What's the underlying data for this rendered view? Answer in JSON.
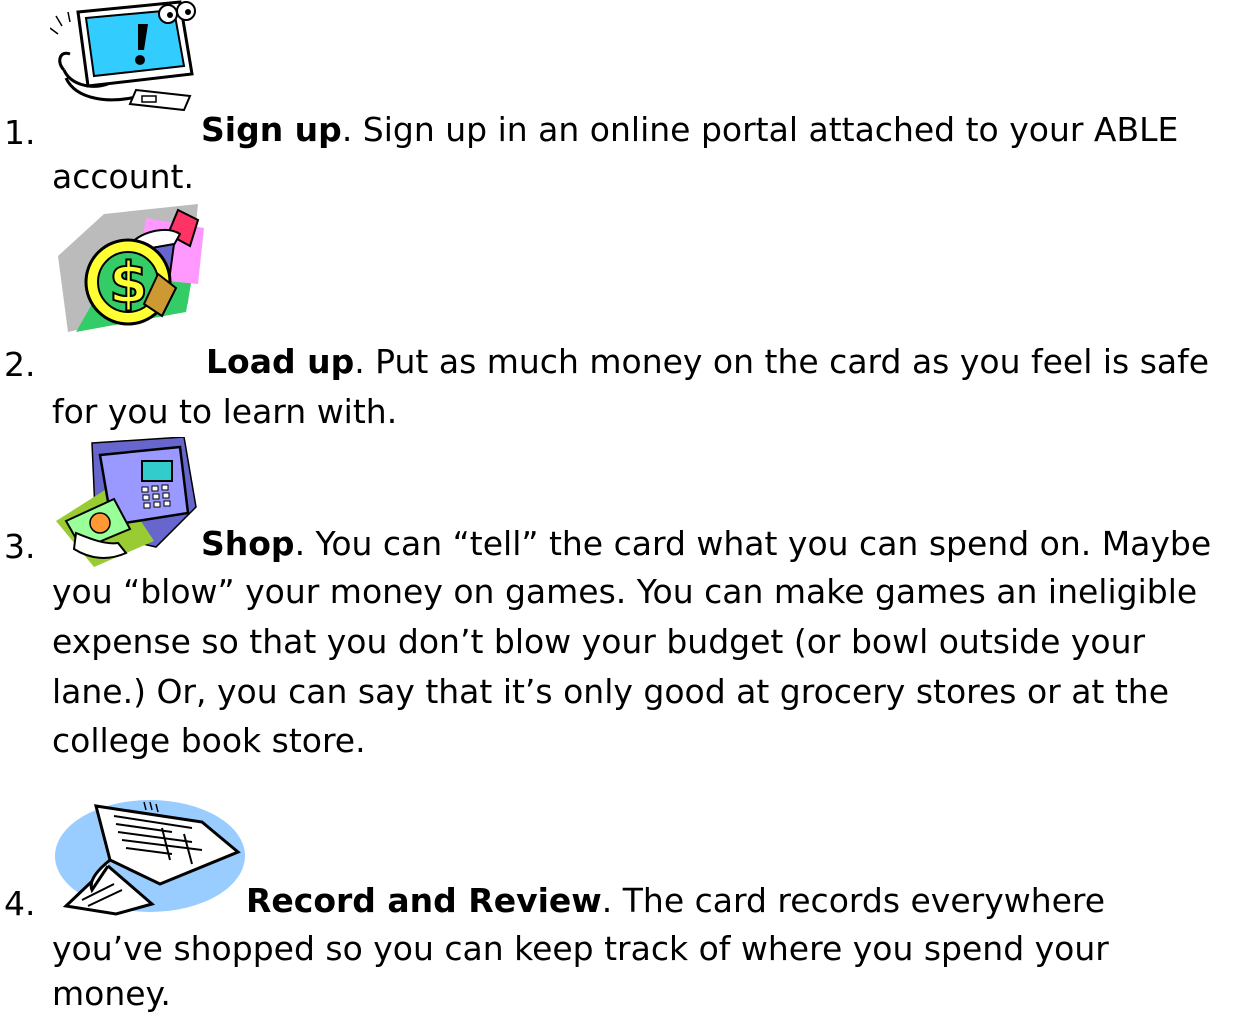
{
  "steps": [
    {
      "number": "1.",
      "title": "Sign up",
      "first_line": ". Sign up in an online portal attached to your ABLE",
      "lines": [
        "account."
      ],
      "icon": "computer-monitor-clipart-icon"
    },
    {
      "number": "2.",
      "title": "Load up",
      "first_line": ". Put as much money on the card as you feel is safe",
      "lines": [
        "for you to learn with."
      ],
      "icon": "money-dollar-clipart-icon"
    },
    {
      "number": "3.",
      "title": "Shop",
      "first_line": ". You can “tell” the card what you can spend on. Maybe",
      "lines": [
        "you “blow” your money on games. You can make games an ineligible",
        "expense so that you don’t blow your budget (or bowl outside your",
        "lane.) Or, you can say that it’s only good at grocery stores or at the",
        "college book store."
      ],
      "icon": "card-payment-terminal-clipart-icon"
    },
    {
      "number": "4.",
      "title": "Record and Review",
      "first_line": ". The card records everywhere",
      "lines": [
        "you’ve shopped so you can keep track of where you spend your",
        "money."
      ],
      "icon": "receipt-clipart-icon"
    }
  ],
  "colors": {
    "text": "#000000",
    "screen_cyan": "#33ccff",
    "dollar_yellow": "#ffff33",
    "money_green": "#33cc66",
    "pink": "#ff99ff",
    "purple_blue": "#6666cc",
    "lime": "#99cc33",
    "sky_blue": "#99ccff"
  }
}
